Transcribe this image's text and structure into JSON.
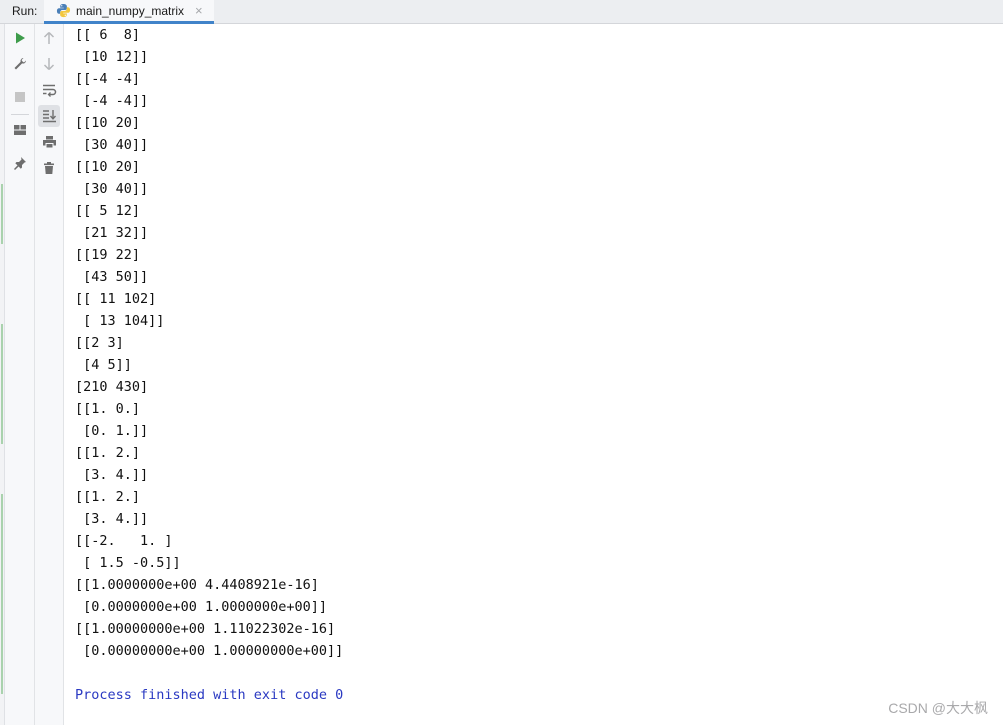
{
  "run_panel": {
    "label": "Run:",
    "tab": {
      "title": "main_numpy_matrix",
      "close_glyph": "×",
      "icon": "python-icon"
    }
  },
  "toolbar": {
    "left_column": [
      {
        "name": "rerun-icon",
        "color": "#3e9c4b"
      },
      {
        "name": "wrench-icon",
        "color": "#6e6e6e"
      },
      {
        "name": "stop-icon",
        "color": "#c5c5c5"
      },
      {
        "name": "layout-icon",
        "color": "#6e6e6e"
      },
      {
        "name": "pin-icon",
        "color": "#6e6e6e"
      }
    ],
    "right_column": [
      {
        "name": "up-arrow-icon",
        "color": "#b6b8bb"
      },
      {
        "name": "down-arrow-icon",
        "color": "#b6b8bb"
      },
      {
        "name": "soft-wrap-icon",
        "color": "#6e6e6e"
      },
      {
        "name": "scroll-to-end-icon",
        "color": "#6e6e6e",
        "active": true
      },
      {
        "name": "print-icon",
        "color": "#6e6e6e"
      },
      {
        "name": "trash-icon",
        "color": "#6e6e6e"
      }
    ]
  },
  "console": {
    "lines": [
      "[[ 6  8]",
      " [10 12]]",
      "[[-4 -4]",
      " [-4 -4]]",
      "[[10 20]",
      " [30 40]]",
      "[[10 20]",
      " [30 40]]",
      "[[ 5 12]",
      " [21 32]]",
      "[[19 22]",
      " [43 50]]",
      "[[ 11 102]",
      " [ 13 104]]",
      "[[2 3]",
      " [4 5]]",
      "[210 430]",
      "[[1. 0.]",
      " [0. 1.]]",
      "[[1. 2.]",
      " [3. 4.]]",
      "[[1. 2.]",
      " [3. 4.]]",
      "[[-2.   1. ]",
      " [ 1.5 -0.5]]",
      "[[1.0000000e+00 4.4408921e-16]",
      " [0.0000000e+00 1.0000000e+00]]",
      "[[1.00000000e+00 1.11022302e-16]",
      " [0.00000000e+00 1.00000000e+00]]"
    ],
    "exit_message": "Process finished with exit code 0",
    "exit_color": "#2a39c2"
  },
  "watermark": "CSDN @大大枫"
}
